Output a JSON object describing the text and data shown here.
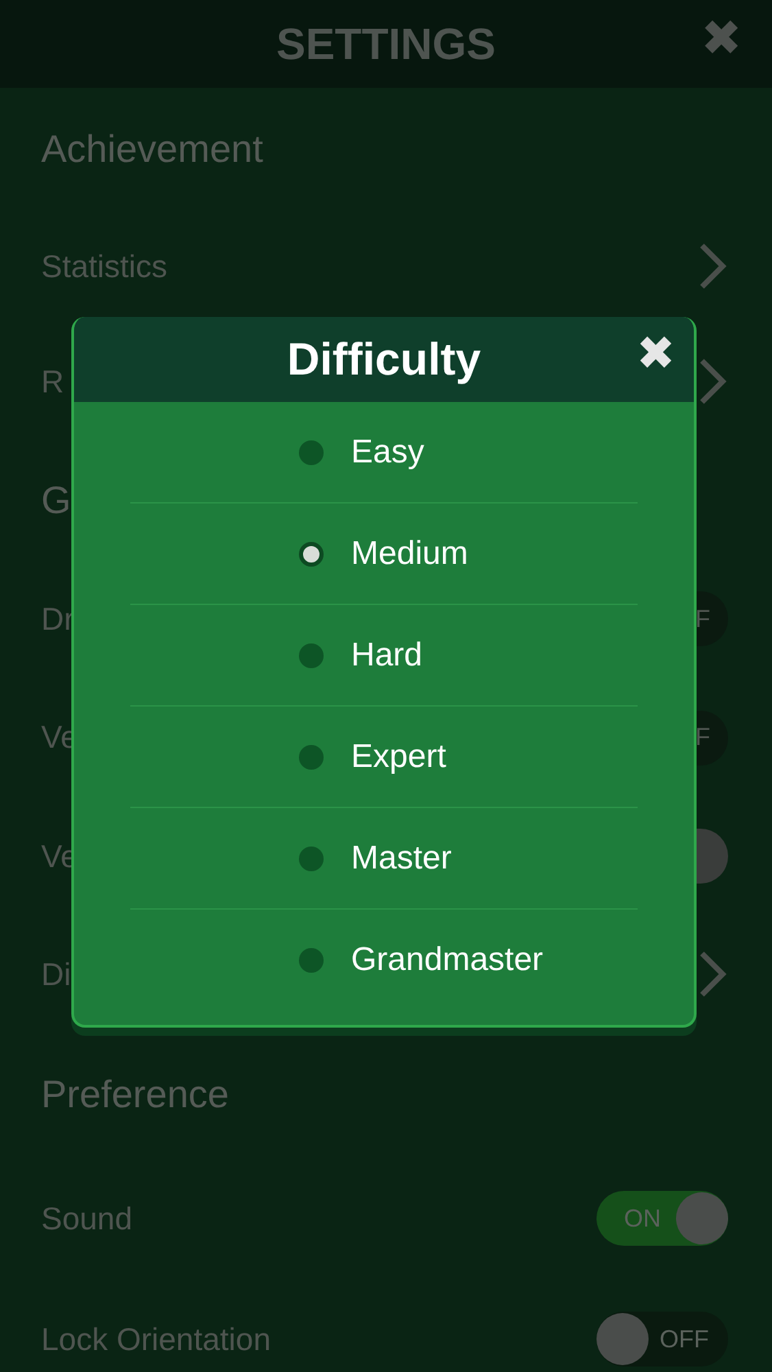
{
  "header": {
    "title": "SETTINGS",
    "close_icon": "✖"
  },
  "settings": [
    {
      "kind": "section",
      "label": "Achievement"
    },
    {
      "kind": "link",
      "label": "Statistics"
    },
    {
      "kind": "link",
      "label": "R"
    },
    {
      "kind": "section",
      "label": "G"
    },
    {
      "kind": "toggle",
      "label": "Dr",
      "on": false,
      "reading": "F"
    },
    {
      "kind": "toggle",
      "label": "Ve",
      "on": false,
      "reading": "F"
    },
    {
      "kind": "toggle",
      "label": "Ve",
      "on": true
    },
    {
      "kind": "link",
      "label": "Di"
    },
    {
      "kind": "section",
      "label": "Preference"
    },
    {
      "kind": "toggle",
      "label": "Sound",
      "on": true,
      "reading": "ON"
    },
    {
      "kind": "toggle",
      "label": "Lock Orientation",
      "on": false,
      "reading": "OFF"
    }
  ],
  "dialog": {
    "title": "Difficulty",
    "close_icon": "✖",
    "options": [
      {
        "label": "Easy",
        "selected": false
      },
      {
        "label": "Medium",
        "selected": true
      },
      {
        "label": "Hard",
        "selected": false
      },
      {
        "label": "Expert",
        "selected": false
      },
      {
        "label": "Master",
        "selected": false
      },
      {
        "label": "Grandmaster",
        "selected": false
      }
    ]
  }
}
